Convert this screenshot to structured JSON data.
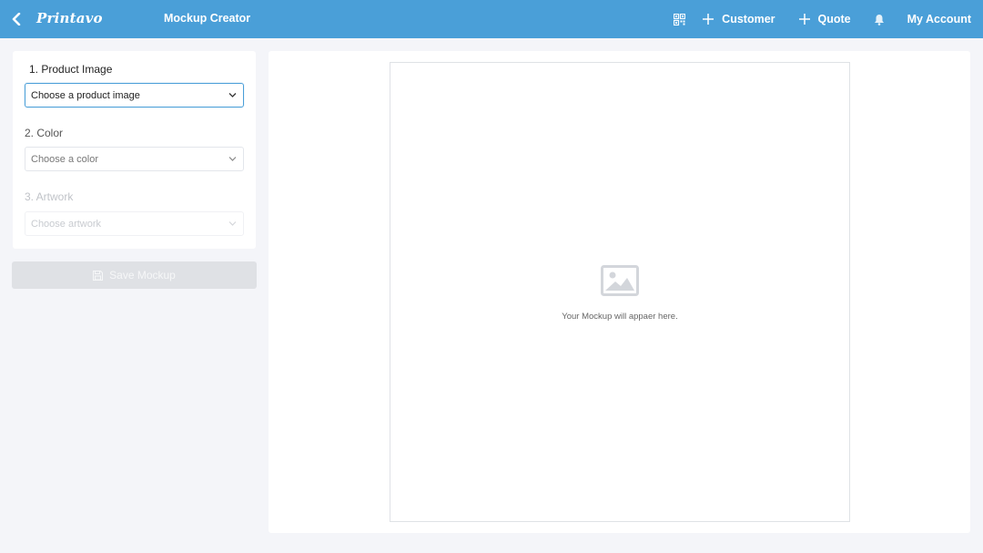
{
  "header": {
    "logo": "Printavo",
    "title": "Mockup Creator",
    "nav": {
      "customer_label": "Customer",
      "quote_label": "Quote",
      "account_label": "My Account"
    }
  },
  "form": {
    "product_image": {
      "label": "1. Product Image",
      "placeholder": "Choose a product image"
    },
    "color": {
      "label": "2. Color",
      "placeholder": "Choose a color"
    },
    "artwork": {
      "label": "3. Artwork",
      "placeholder": "Choose artwork"
    },
    "save_label": "Save Mockup"
  },
  "preview": {
    "empty_text": "Your Mockup will appaer here."
  },
  "colors": {
    "header_bg": "#4a9fd8",
    "page_bg": "#f4f5f9",
    "disabled_button": "#dfe1e5"
  },
  "icons": [
    "back-chevron-icon",
    "qr-code-icon",
    "plus-icon",
    "bell-icon",
    "chevron-down-icon",
    "floppy-disk-icon",
    "image-placeholder-icon"
  ]
}
